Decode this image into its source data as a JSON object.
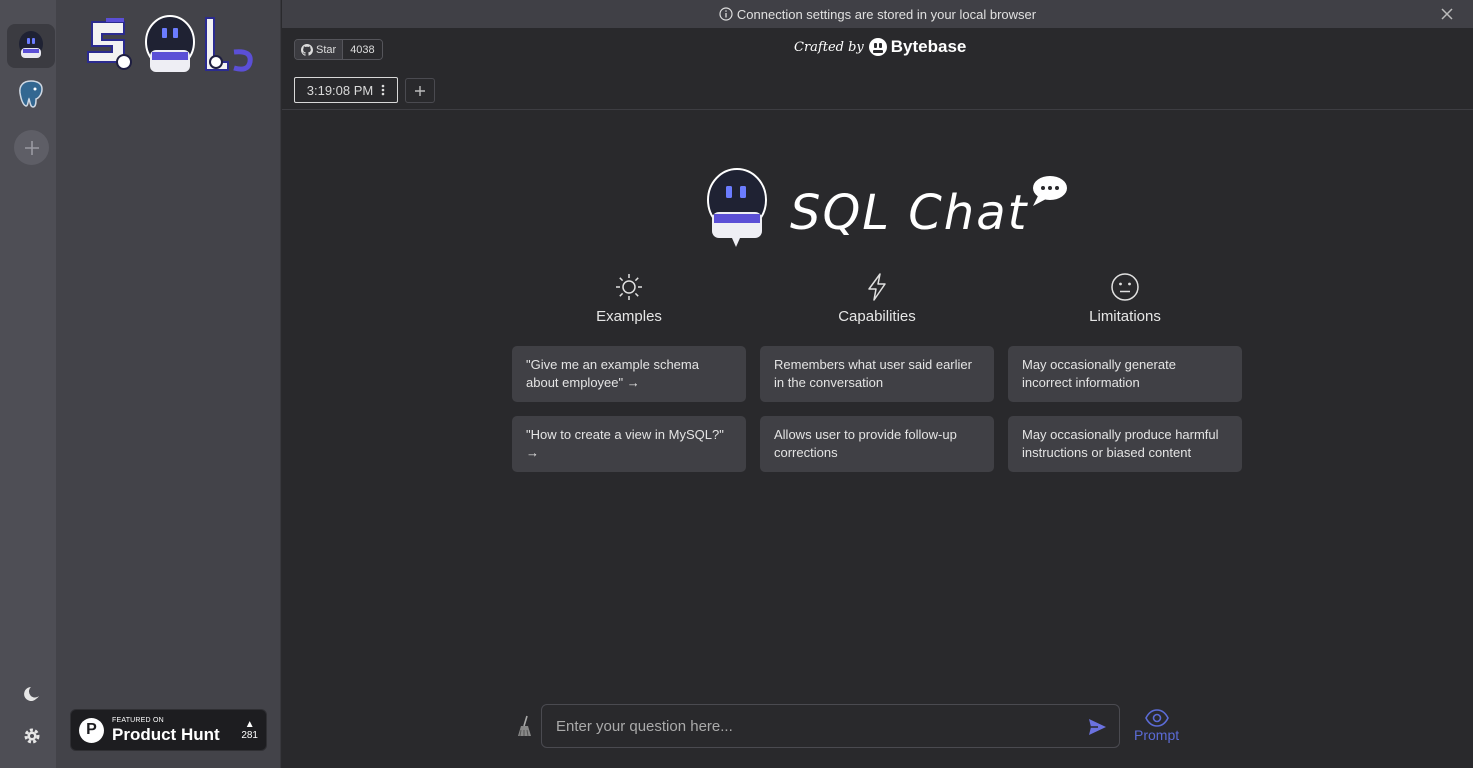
{
  "banner": {
    "text": "Connection settings are stored in your local browser"
  },
  "github": {
    "star_label": "Star",
    "star_count": "4038"
  },
  "crafted": {
    "prefix": "Crafted by",
    "brand": "Bytebase"
  },
  "tabs": [
    {
      "label": "3:19:08 PM"
    }
  ],
  "hero": {
    "title": "SQL Chat"
  },
  "columns": [
    {
      "title": "Examples",
      "icon": "sun-icon",
      "cards": [
        "\"Give me an example schema about employee\" →",
        "\"How to create a view in MySQL?\" →"
      ]
    },
    {
      "title": "Capabilities",
      "icon": "lightning-icon",
      "cards": [
        "Remembers what user said earlier in the conversation",
        "Allows user to provide follow-up corrections"
      ]
    },
    {
      "title": "Limitations",
      "icon": "neutral-face-icon",
      "cards": [
        "May occasionally generate incorrect information",
        "May occasionally produce harmful instructions or biased content"
      ]
    }
  ],
  "input": {
    "placeholder": "Enter your question here..."
  },
  "prompt": {
    "label": "Prompt"
  },
  "product_hunt": {
    "featured": "FEATURED ON",
    "name": "Product Hunt",
    "count": "281"
  },
  "colors": {
    "accent": "#5b6bd6",
    "rail": "#4e4e55",
    "panel": "#434349",
    "main": "#29292c"
  }
}
